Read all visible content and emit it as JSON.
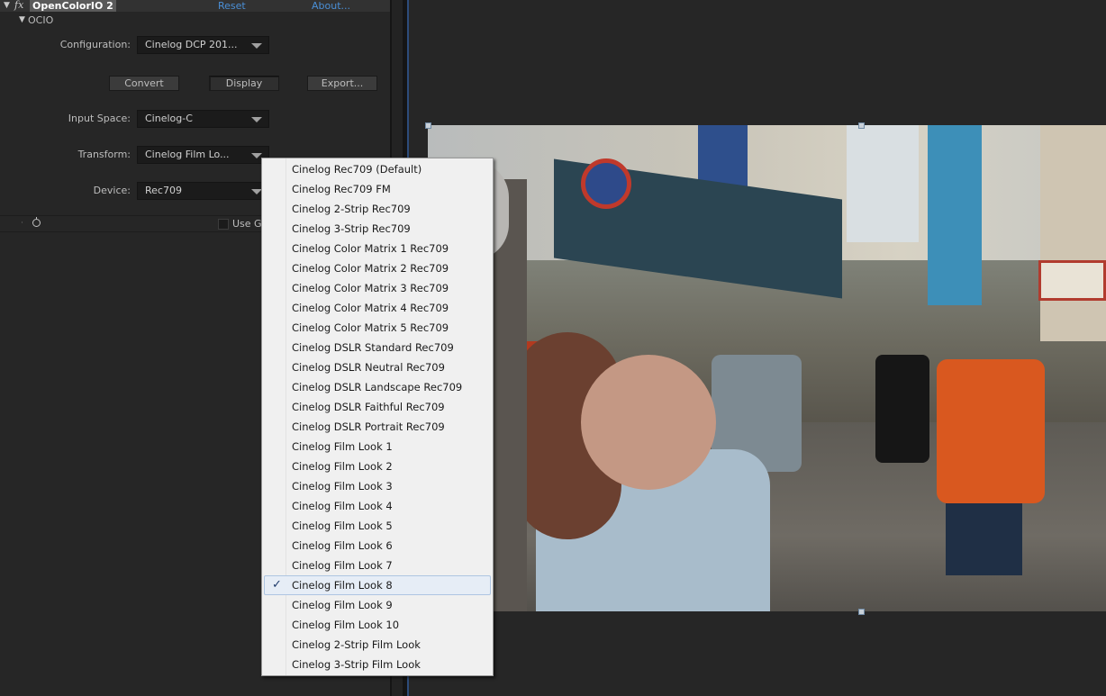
{
  "effect_header": {
    "fx": "fx",
    "name": "OpenColorIO 2",
    "reset": "Reset",
    "about": "About..."
  },
  "ocio_group": "OCIO",
  "params": {
    "configuration": {
      "label": "Configuration:",
      "value": "Cinelog DCP 201..."
    },
    "input_space": {
      "label": "Input Space:",
      "value": "Cinelog-C"
    },
    "transform": {
      "label": "Transform:",
      "value": "Cinelog Film Lo..."
    },
    "device": {
      "label": "Device:",
      "value": "Rec709"
    }
  },
  "buttons": {
    "convert": "Convert",
    "display": "Display",
    "export": "Export..."
  },
  "gpu_label": "Use G",
  "menu": {
    "items": [
      "Cinelog Rec709 (Default)",
      "Cinelog Rec709 FM",
      "Cinelog 2-Strip Rec709",
      "Cinelog 3-Strip Rec709",
      "Cinelog Color Matrix 1 Rec709",
      "Cinelog Color Matrix 2 Rec709",
      "Cinelog Color Matrix 3 Rec709",
      "Cinelog Color Matrix 4 Rec709",
      "Cinelog Color Matrix 5 Rec709",
      "Cinelog DSLR Standard Rec709",
      "Cinelog DSLR Neutral Rec709",
      "Cinelog DSLR Landscape Rec709",
      "Cinelog DSLR Faithful Rec709",
      "Cinelog DSLR Portrait Rec709",
      "Cinelog Film Look 1",
      "Cinelog Film Look 2",
      "Cinelog Film Look 3",
      "Cinelog Film Look 4",
      "Cinelog Film Look 5",
      "Cinelog Film Look 6",
      "Cinelog Film Look 7",
      "Cinelog Film Look 8",
      "Cinelog Film Look 9",
      "Cinelog Film Look 10",
      "Cinelog 2-Strip Film Look",
      "Cinelog 3-Strip Film Look"
    ],
    "selected_index": 21,
    "check": "✓"
  },
  "colors": {
    "panel": "#262626",
    "link": "#4a8fd6",
    "menu_bg": "#f0f0f0",
    "menu_selected": "#e6edf6"
  }
}
